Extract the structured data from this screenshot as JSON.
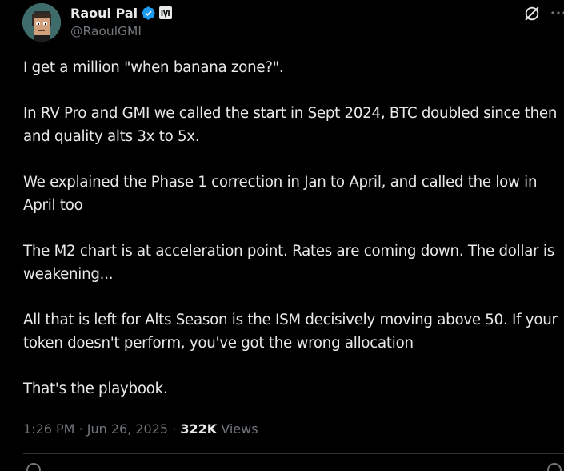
{
  "author": {
    "display_name": "Raoul Pal",
    "handle": "@RaoulGMI",
    "verified_icon": "verified-badge-icon",
    "affiliate_icon": "affiliate-badge-icon"
  },
  "header_icons": {
    "grok": "grok-icon",
    "more": "more-icon"
  },
  "tweet": {
    "paragraphs": [
      "I get a million \"when banana zone?\".",
      "In RV Pro and GMI we called the start in Sept 2024, BTC doubled since then and quality alts 3x to 5x.",
      "We explained the Phase 1 correction in Jan to April, and called the low in April too",
      "The M2 chart is at acceleration point. Rates are coming down. The dollar is weakening...",
      "All that is left for Alts Season is the ISM decisively moving above 50. If your token doesn't perform, you've got the wrong allocation",
      "That's the playbook."
    ]
  },
  "meta": {
    "time": "1:26 PM",
    "separator": "·",
    "date": "Jun 26, 2025",
    "views_count": "322K",
    "views_label": "Views"
  },
  "colors": {
    "background": "#000000",
    "text": "#e7e9ea",
    "muted": "#71767b",
    "verified": "#1d9bf0",
    "divider": "#2f3336"
  }
}
